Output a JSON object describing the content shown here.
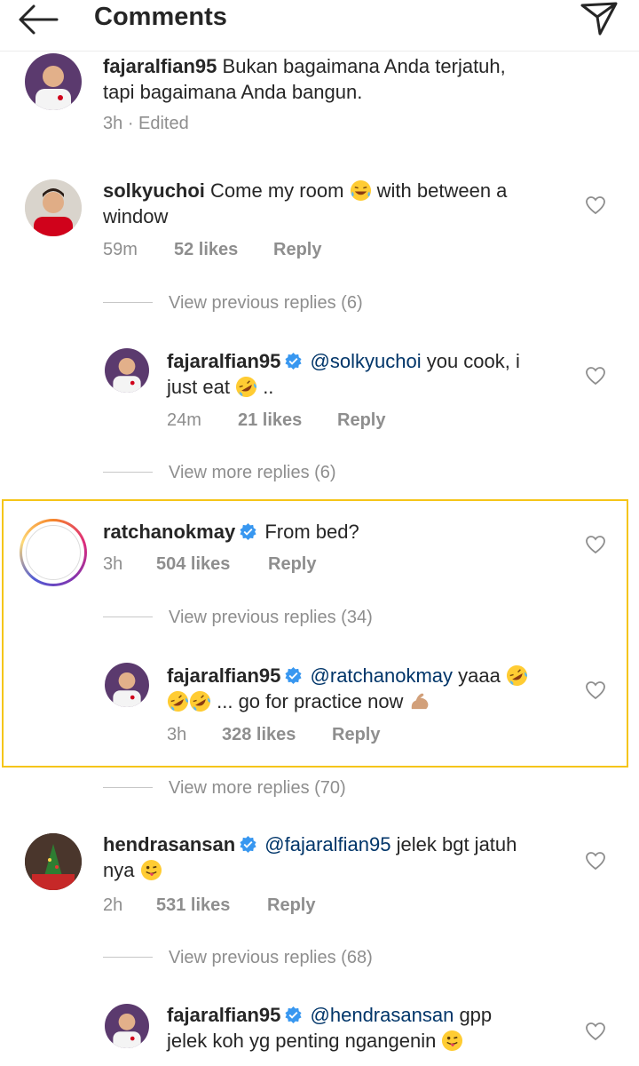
{
  "header": {
    "title": "Comments",
    "back_icon": "arrow-left-icon",
    "send_icon": "paper-plane-icon"
  },
  "comments": [
    {
      "username": "fajaralfian95",
      "text": "Bukan bagaimana Anda terjatuh,",
      "text2": "tapi bagaimana Anda bangun.",
      "time": "3h",
      "edited": "· Edited"
    },
    {
      "username": "solkyuchoi",
      "text_a": "Come my room",
      "text_b": "with  between a",
      "text2": "window",
      "time": "59m",
      "likes": "52 likes",
      "reply": "Reply",
      "view_previous": "View previous replies (6)"
    },
    {
      "username": "fajaralfian95",
      "mention": "@solkyuchoi",
      "text_a": "you cook, i",
      "text2_a": "just eat",
      "text2_b": "..",
      "time": "24m",
      "likes": "21 likes",
      "reply": "Reply",
      "view_more": "View more replies (6)"
    },
    {
      "username": "ratchanokmay",
      "text": "From bed?",
      "time": "3h",
      "likes": "504 likes",
      "reply": "Reply",
      "view_previous": "View previous replies (34)"
    },
    {
      "username": "fajaralfian95",
      "mention": "@ratchanokmay",
      "text_a": "yaaa",
      "text2": "... go for practice now",
      "time": "3h",
      "likes": "328 likes",
      "reply": "Reply",
      "view_more": "View more replies (70)"
    },
    {
      "username": "hendrasansan",
      "mention": "@fajaralfian95",
      "text_a": "jelek bgt jatuh",
      "text2": "nya",
      "time": "2h",
      "likes": "531 likes",
      "reply": "Reply",
      "view_previous": "View previous replies (68)"
    },
    {
      "username": "fajaralfian95",
      "mention": "@hendrasansan",
      "text_a": "gpp",
      "text2": "jelek koh yg penting ngangenin"
    }
  ],
  "colors": {
    "text": "#262626",
    "muted": "#8e8e8e",
    "mention": "#003569",
    "verified": "#3897f0",
    "highlight": "#f5c518"
  }
}
